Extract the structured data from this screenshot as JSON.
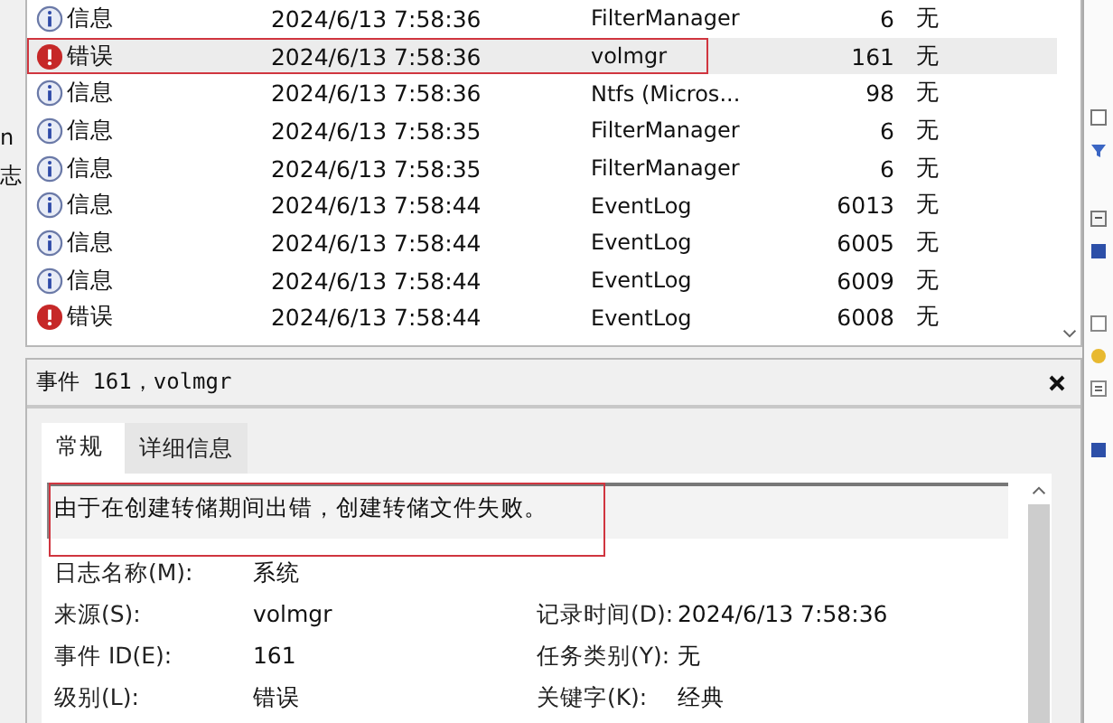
{
  "left_panel": {
    "fragments": [
      "n",
      "志"
    ]
  },
  "events": {
    "rows": [
      {
        "kind": "info",
        "level": "信息",
        "date": "2024/6/13 7:58:36",
        "source": "FilterManager",
        "event_id": "6",
        "task": "无",
        "selected": false
      },
      {
        "kind": "error",
        "level": "错误",
        "date": "2024/6/13 7:58:36",
        "source": "volmgr",
        "event_id": "161",
        "task": "无",
        "selected": true
      },
      {
        "kind": "info",
        "level": "信息",
        "date": "2024/6/13 7:58:36",
        "source": "Ntfs (Micros...",
        "event_id": "98",
        "task": "无",
        "selected": false
      },
      {
        "kind": "info",
        "level": "信息",
        "date": "2024/6/13 7:58:35",
        "source": "FilterManager",
        "event_id": "6",
        "task": "无",
        "selected": false
      },
      {
        "kind": "info",
        "level": "信息",
        "date": "2024/6/13 7:58:35",
        "source": "FilterManager",
        "event_id": "6",
        "task": "无",
        "selected": false
      },
      {
        "kind": "info",
        "level": "信息",
        "date": "2024/6/13 7:58:44",
        "source": "EventLog",
        "event_id": "6013",
        "task": "无",
        "selected": false
      },
      {
        "kind": "info",
        "level": "信息",
        "date": "2024/6/13 7:58:44",
        "source": "EventLog",
        "event_id": "6005",
        "task": "无",
        "selected": false
      },
      {
        "kind": "info",
        "level": "信息",
        "date": "2024/6/13 7:58:44",
        "source": "EventLog",
        "event_id": "6009",
        "task": "无",
        "selected": false
      },
      {
        "kind": "error",
        "level": "错误",
        "date": "2024/6/13 7:58:44",
        "source": "EventLog",
        "event_id": "6008",
        "task": "无",
        "selected": false
      }
    ]
  },
  "detail": {
    "title": "事件 161，volmgr",
    "tabs": [
      {
        "label": "常规",
        "selected": true
      },
      {
        "label": "详细信息",
        "selected": false
      }
    ],
    "description": "由于在创建转储期间出错，创建转储文件失败。",
    "rows": [
      {
        "left": {
          "label": "日志名称(M):",
          "value": "系统"
        }
      },
      {
        "left": {
          "label": "来源(S):",
          "value": "volmgr"
        },
        "right": {
          "label": "记录时间(D):",
          "value": "2024/6/13 7:58:36"
        }
      },
      {
        "left": {
          "label": "事件 ID(E):",
          "value": "161"
        },
        "right": {
          "label": "任务类别(Y):",
          "value": "无"
        }
      },
      {
        "left": {
          "label": "级别(L):",
          "value": "错误"
        },
        "right": {
          "label": "关键字(K):",
          "value": "经典"
        }
      }
    ]
  }
}
